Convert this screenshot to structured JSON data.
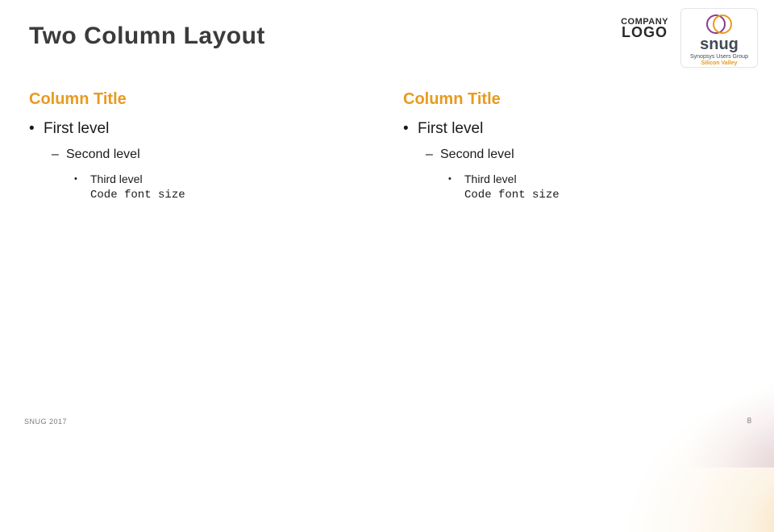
{
  "title": "Two Column Layout",
  "logo": {
    "top": "COMPANY",
    "bottom": "LOGO"
  },
  "snug": {
    "name": "snug",
    "sub": "Synopsys Users Group",
    "region": "Silicon Valley"
  },
  "columns": {
    "left": {
      "title": "Column Title",
      "level1": "First level",
      "level2": "Second level",
      "level3": "Third level",
      "code": "Code font size"
    },
    "right": {
      "title": "Column Title",
      "level1": "First level",
      "level2": "Second level",
      "level3": "Third level",
      "code": "Code font size"
    }
  },
  "footer": {
    "left": "SNUG 2017",
    "page": "8"
  }
}
